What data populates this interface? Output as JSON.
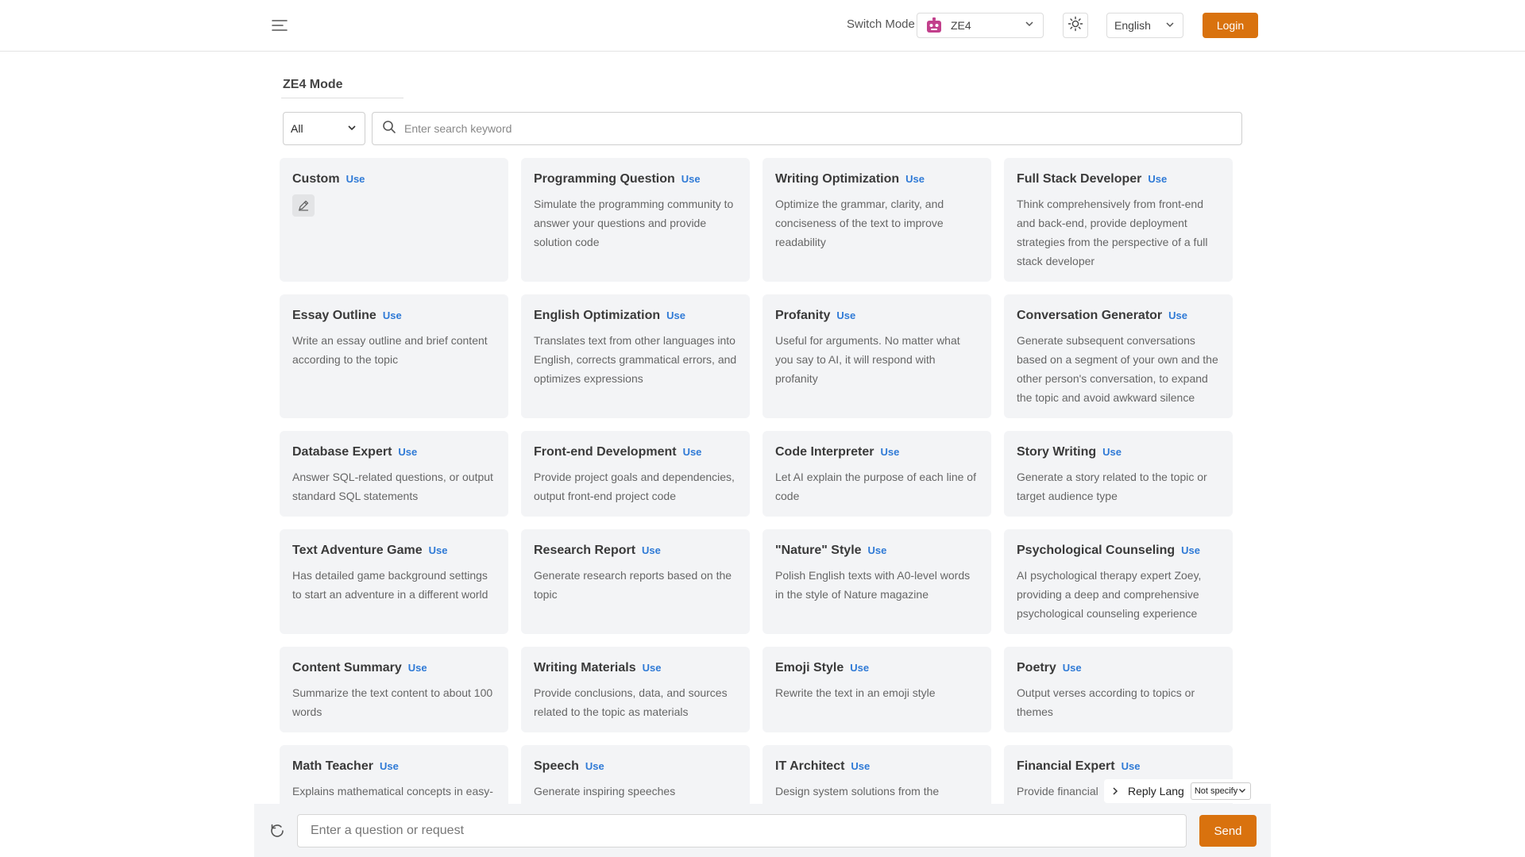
{
  "header": {
    "switch_mode_label": "Switch Mode",
    "mode_value": "ZE4",
    "language_value": "English",
    "login_label": "Login",
    "accent_color": "#d9720e"
  },
  "main": {
    "mode_title": "ZE4 Mode",
    "category_value": "All",
    "search_placeholder": "Enter search keyword",
    "use_label": "Use",
    "cards": [
      {
        "title": "Custom",
        "desc": ""
      },
      {
        "title": "Programming Question",
        "desc": "Simulate the programming community to answer your questions and provide solution code"
      },
      {
        "title": "Writing Optimization",
        "desc": "Optimize the grammar, clarity, and conciseness of the text to improve readability"
      },
      {
        "title": "Full Stack Developer",
        "desc": "Think comprehensively from front-end and back-end, provide deployment strategies from the perspective of a full stack developer"
      },
      {
        "title": "Essay Outline",
        "desc": "Write an essay outline and brief content according to the topic"
      },
      {
        "title": "English Optimization",
        "desc": "Translates text from other languages into English, corrects grammatical errors, and optimizes expressions"
      },
      {
        "title": "Profanity",
        "desc": "Useful for arguments. No matter what you say to AI, it will respond with profanity"
      },
      {
        "title": "Conversation Generator",
        "desc": "Generate subsequent conversations based on a segment of your own and the other person's conversation, to expand the topic and avoid awkward silence"
      },
      {
        "title": "Database Expert",
        "desc": "Answer SQL-related questions, or output standard SQL statements"
      },
      {
        "title": "Front-end Development",
        "desc": "Provide project goals and dependencies, output front-end project code"
      },
      {
        "title": "Code Interpreter",
        "desc": "Let AI explain the purpose of each line of code"
      },
      {
        "title": "Story Writing",
        "desc": "Generate a story related to the topic or target audience type"
      },
      {
        "title": "Text Adventure Game",
        "desc": "Has detailed game background settings to start an adventure in a different world"
      },
      {
        "title": "Research Report",
        "desc": "Generate research reports based on the topic"
      },
      {
        "title": "\"Nature\" Style",
        "desc": "Polish English texts with A0-level words in the style of Nature magazine"
      },
      {
        "title": "Psychological Counseling",
        "desc": "AI psychological therapy expert Zoey, providing a deep and comprehensive psychological counseling experience"
      },
      {
        "title": "Content Summary",
        "desc": "Summarize the text content to about 100 words"
      },
      {
        "title": "Writing Materials",
        "desc": "Provide conclusions, data, and sources related to the topic as materials"
      },
      {
        "title": "Emoji Style",
        "desc": "Rewrite the text in an emoji style"
      },
      {
        "title": "Poetry",
        "desc": "Output verses according to topics or themes"
      },
      {
        "title": "Math Teacher",
        "desc": "Explains mathematical concepts in easy-"
      },
      {
        "title": "Speech",
        "desc": "Generate inspiring speeches"
      },
      {
        "title": "IT Architect",
        "desc": "Design system solutions from the"
      },
      {
        "title": "Financial Expert",
        "desc": "Provide financial"
      }
    ]
  },
  "reply_lang": {
    "label": "Reply Lang",
    "value": "Not specify"
  },
  "bottom": {
    "question_placeholder": "Enter a question or request",
    "send_label": "Send"
  }
}
